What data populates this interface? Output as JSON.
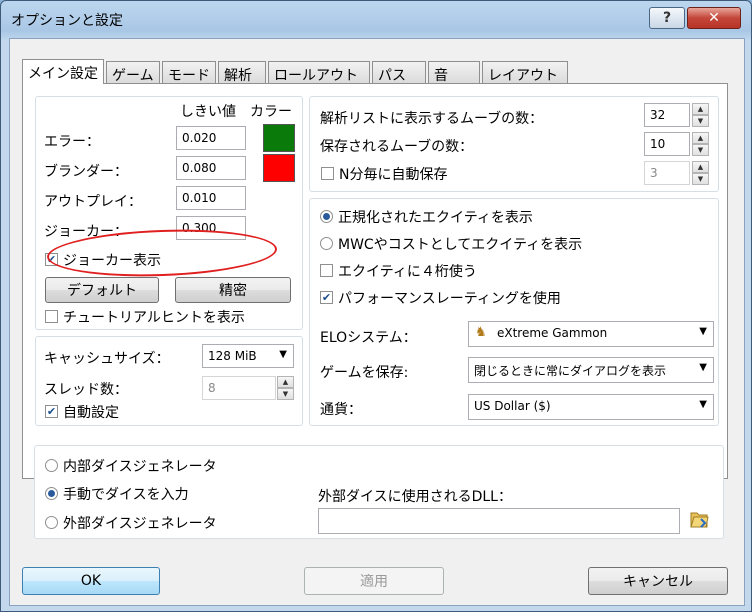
{
  "window": {
    "title": "オプションと設定",
    "help": "?",
    "close": "✕"
  },
  "tabs": [
    {
      "label": "メイン設定"
    },
    {
      "label": "ゲーム"
    },
    {
      "label": "モード"
    },
    {
      "label": "解析"
    },
    {
      "label": "ロールアウト"
    },
    {
      "label": "パス"
    },
    {
      "label": "音"
    },
    {
      "label": "レイアウト"
    }
  ],
  "thresholds": {
    "col_threshold": "しきい値",
    "col_color": "カラー",
    "rows": [
      {
        "label": "エラー：",
        "value": "0.020",
        "color": "#0a7a0a"
      },
      {
        "label": "ブランダー：",
        "value": "0.080",
        "color": "#ff0000"
      },
      {
        "label": "アウトプレイ：",
        "value": "0.010"
      },
      {
        "label": "ジョーカー：",
        "value": "0.300"
      }
    ],
    "show_jokers": "ジョーカー表示",
    "default_button": "デフォルト",
    "precise_button": "精密",
    "tutorial_hint": "チュートリアルヒントを表示"
  },
  "cache": {
    "cache_label": "キャッシュサイズ：",
    "cache_value": "128 MiB",
    "threads_label": "スレッド数：",
    "threads_value": "8",
    "auto_label": "自動設定"
  },
  "analysis": {
    "moves_label": "解析リストに表示するムーブの数：",
    "moves_value": "32",
    "saved_label": "保存されるムーブの数：",
    "saved_value": "10",
    "autosave_label": "N分毎に自動保存",
    "autosave_value": "3"
  },
  "equity": {
    "normalized": "正規化されたエクイティを表示",
    "mwc": "MWCやコストとしてエクイティを表示",
    "four_digits": "エクイティに４桁使う",
    "performance": "パフォーマンスレーティングを使用",
    "elo_label": "ELOシステム：",
    "elo_value": "eXtreme Gammon",
    "save_label": "ゲームを保存:",
    "save_value": "閉じるときに常にダイアログを表示",
    "currency_label": "通貨：",
    "currency_value": "US Dollar ($)"
  },
  "dice": {
    "internal": "内部ダイスジェネレータ",
    "manual": "手動でダイスを入力",
    "external": "外部ダイスジェネレータ",
    "dll_label": "外部ダイスに使用されるDLL：",
    "dll_value": ""
  },
  "footer": {
    "ok": "OK",
    "apply": "適用",
    "cancel": "キャンセル"
  }
}
